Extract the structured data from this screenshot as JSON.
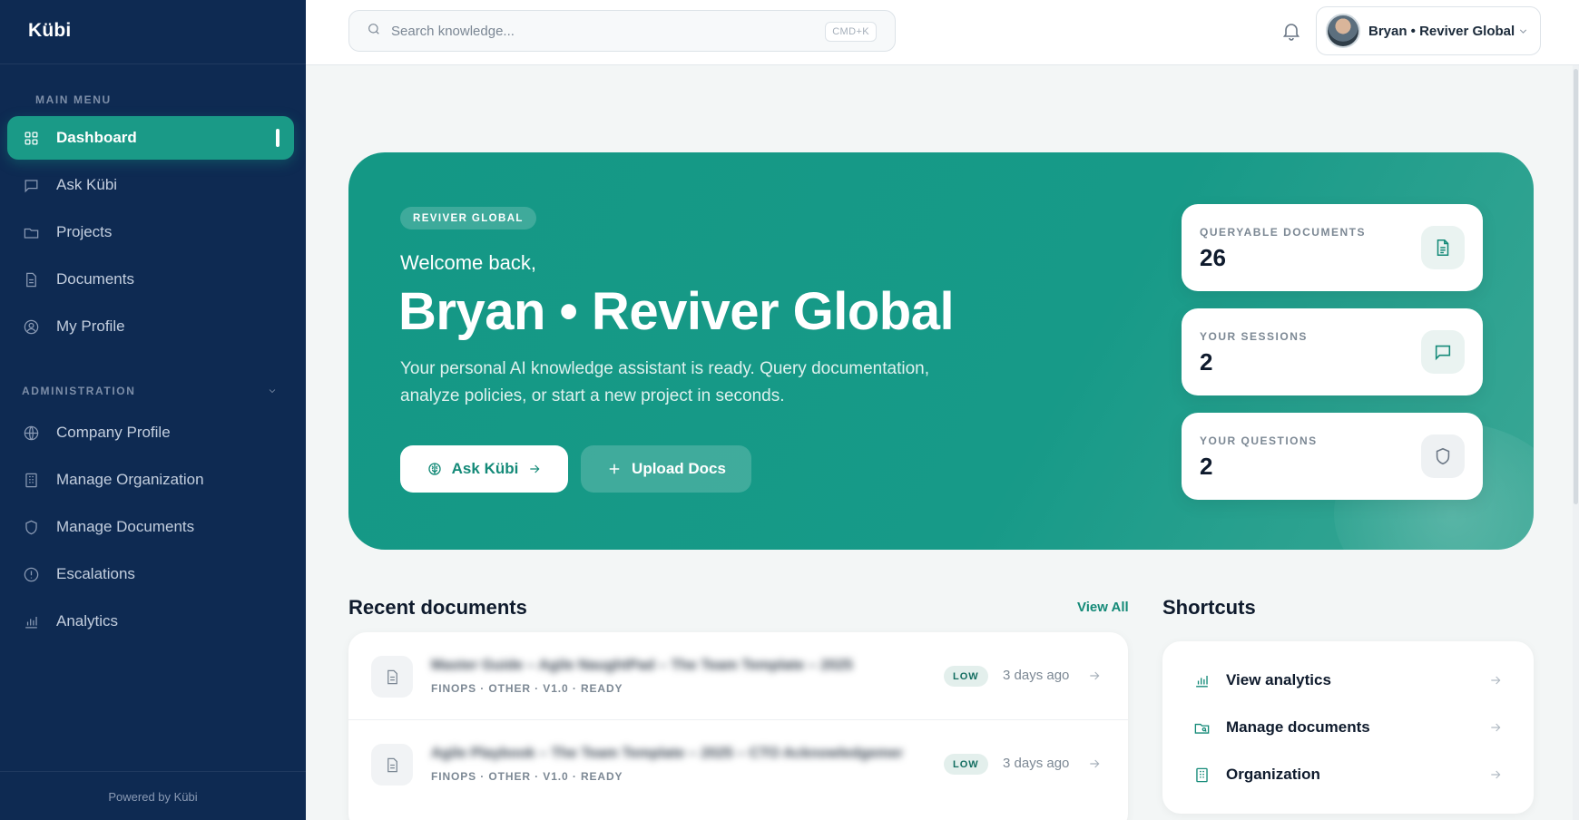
{
  "sidebar": {
    "brand": "Kübi",
    "main_menu_label": "MAIN MENU",
    "main_items": [
      {
        "label": "Dashboard",
        "icon": "grid-icon",
        "active": true
      },
      {
        "label": "Ask Kübi",
        "icon": "chat-icon"
      },
      {
        "label": "Projects",
        "icon": "folder-icon"
      },
      {
        "label": "Documents",
        "icon": "document-icon"
      },
      {
        "label": "My Profile",
        "icon": "user-circle-icon"
      }
    ],
    "admin_label": "ADMINISTRATION",
    "admin_items": [
      {
        "label": "Company Profile",
        "icon": "globe-icon"
      },
      {
        "label": "Manage Organization",
        "icon": "building-icon"
      },
      {
        "label": "Manage Documents",
        "icon": "shield-icon"
      },
      {
        "label": "Escalations",
        "icon": "alert-circle-icon"
      },
      {
        "label": "Analytics",
        "icon": "bar-chart-icon"
      }
    ],
    "powered_by": "Powered by Kübi"
  },
  "topbar": {
    "search_placeholder": "Search knowledge...",
    "search_shortcut": "CMD+K",
    "user_name": "Bryan • Reviver Global"
  },
  "hero": {
    "badge": "REVIVER GLOBAL",
    "welcome": "Welcome back,",
    "title": "Bryan • Reviver Global",
    "description": "Your personal AI knowledge assistant is ready. Query documentation, analyze policies, or start a new project in seconds.",
    "primary_button": "Ask Kübi",
    "secondary_button": "Upload Docs",
    "stats": [
      {
        "label": "QUERYABLE DOCUMENTS",
        "value": "26",
        "icon": "file-text-icon"
      },
      {
        "label": "YOUR SESSIONS",
        "value": "2",
        "icon": "message-square-icon"
      },
      {
        "label": "YOUR QUESTIONS",
        "value": "2",
        "icon": "shield-icon"
      }
    ]
  },
  "recent": {
    "title": "Recent documents",
    "view_all": "View All",
    "docs": [
      {
        "title": "Master Guide – Agile NaughtPad – The Team Template – 2025",
        "meta": "FINOPS · OTHER · V1.0 · READY",
        "badge": "LOW",
        "time": "3 days ago"
      },
      {
        "title": "Agile Playbook – The Team Template – 2025 – CTO Acknowledgements",
        "meta": "FINOPS · OTHER · V1.0 · READY",
        "badge": "LOW",
        "time": "3 days ago"
      }
    ]
  },
  "shortcuts": {
    "title": "Shortcuts",
    "items": [
      {
        "label": "View analytics",
        "icon": "bar-chart-icon"
      },
      {
        "label": "Manage documents",
        "icon": "folder-search-icon"
      },
      {
        "label": "Organization",
        "icon": "building-icon"
      }
    ]
  },
  "colors": {
    "sidebar_bg": "#0e2a52",
    "accent": "#1a9a87",
    "hero_bg": "#149885"
  }
}
